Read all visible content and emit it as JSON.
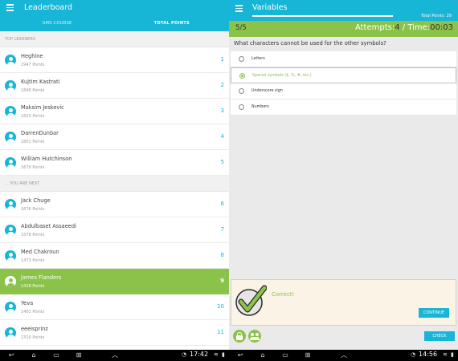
{
  "left": {
    "title": "Leaderboard",
    "tabs": [
      "SMS COURSE",
      "TOTAL POINTS"
    ],
    "sections": {
      "top": "TOP LEARNERS",
      "next": "... YOU ARE NEXT"
    },
    "top_learners": [
      {
        "name": "Heghine",
        "points": "2947 Points",
        "rank": "1"
      },
      {
        "name": "Kujtim Kastrati",
        "points": "1848 Points",
        "rank": "2"
      },
      {
        "name": "Maksim Jeskevic",
        "points": "1820 Points",
        "rank": "3"
      },
      {
        "name": "DarrenDunbar",
        "points": "1801 Points",
        "rank": "4"
      },
      {
        "name": "William Hutchinson",
        "points": "1679 Points",
        "rank": "5"
      }
    ],
    "next_learners": [
      {
        "name": "Jack Chuge",
        "points": "1676 Points",
        "rank": "6"
      },
      {
        "name": "Abdulbaset Assaeedi",
        "points": "1578 Points",
        "rank": "7"
      },
      {
        "name": "Med Chakroun",
        "points": "1473 Points",
        "rank": "8"
      },
      {
        "name": "James Flanders",
        "points": "1416 Points",
        "rank": "9"
      },
      {
        "name": "Yeva",
        "points": "1401 Points",
        "rank": "10"
      },
      {
        "name": "eeeisprinz",
        "points": "1310 Points",
        "rank": "11"
      }
    ],
    "clock": "17:42"
  },
  "right": {
    "title": "Variables",
    "progress": 1.0,
    "total_points": "Total Points: 29",
    "question_count": "5/5",
    "attempts_label": "Attempts:",
    "attempts_value": "4",
    "time_label": " / Time:",
    "time_value": "00:03",
    "question": "What characters cannot be used for the other symbols?",
    "options": [
      {
        "label": "Letters",
        "selected": false
      },
      {
        "label": "Special symbols ($, %, #, etc.)",
        "selected": true
      },
      {
        "label": "Underscore sign",
        "selected": false
      },
      {
        "label": "Numbers",
        "selected": false
      }
    ],
    "feedback": "Correct!",
    "continue_label": "CONTINUE",
    "check_label": "CHECK",
    "clock": "14:56"
  },
  "colors": {
    "primary": "#17b5d6",
    "accent": "#8bc34a",
    "feedback_bg": "#faf3e6"
  },
  "icons": [
    "menu-icon",
    "avatar-icon",
    "lock-icon",
    "people-icon",
    "checkmark-icon",
    "back-icon",
    "home-icon",
    "recent-apps-icon",
    "screenshot-icon",
    "up-icon",
    "wifi-icon",
    "battery-icon"
  ]
}
